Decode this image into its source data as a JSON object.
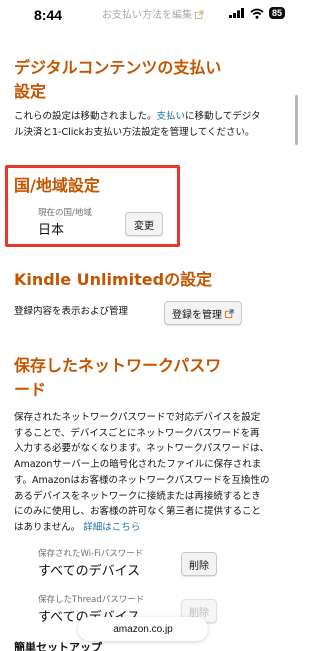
{
  "status_bar": {
    "time": "8:44",
    "battery": "85",
    "faded_link": "お支払い方法を編集"
  },
  "digital": {
    "title_line1": "デジタルコンテンツの支払い",
    "title_line2": "設定",
    "desc_before": "これらの設定は移動されました。",
    "desc_link": "支払い",
    "desc_after1": "に移動してデジタ",
    "desc_line2": "ル決済と1-Clickお支払い方法設定を管理してください。"
  },
  "country": {
    "title": "国/地域設定",
    "label": "現在の国/地域",
    "value": "日本",
    "button": "変更"
  },
  "kindle": {
    "title": "Kindle Unlimitedの設定",
    "desc": "登録内容を表示および管理",
    "button": "登録を管理"
  },
  "network": {
    "title_line1": "保存したネットワークパスワ",
    "title_line2": "ード",
    "lines": [
      "保存されたネットワークパスワードで対応デバイスを設定",
      "することで、デバイスごとにネットワークパスワードを再",
      "入力する必要がなくなります。ネットワークパスワードは、",
      "Amazonサーバー上の暗号化されたファイルに保存されま",
      "す。Amazonはお客様のネットワークパスワードを互換性の",
      "あるデバイスをネットワークに接続または再接続するとき",
      "にのみに使用し、お客様の許可なく第三者に提供すること"
    ],
    "last_line": "はありません。",
    "more_link": "詳細はこちら",
    "wifi_label": "保存されたWi-Fiパスワード",
    "wifi_value": "すべてのデバイス",
    "wifi_button": "削除",
    "thread_label": "保存したThreadパスワード",
    "thread_value": "すべてのデバイス",
    "thread_button": "削除"
  },
  "setup": {
    "title": "簡単セットアップ"
  },
  "url_bar": {
    "domain": "amazon.co.jp"
  },
  "colors": {
    "heading": "#c45500",
    "link": "#1c6fa8",
    "highlight_box": "#e8362b"
  }
}
